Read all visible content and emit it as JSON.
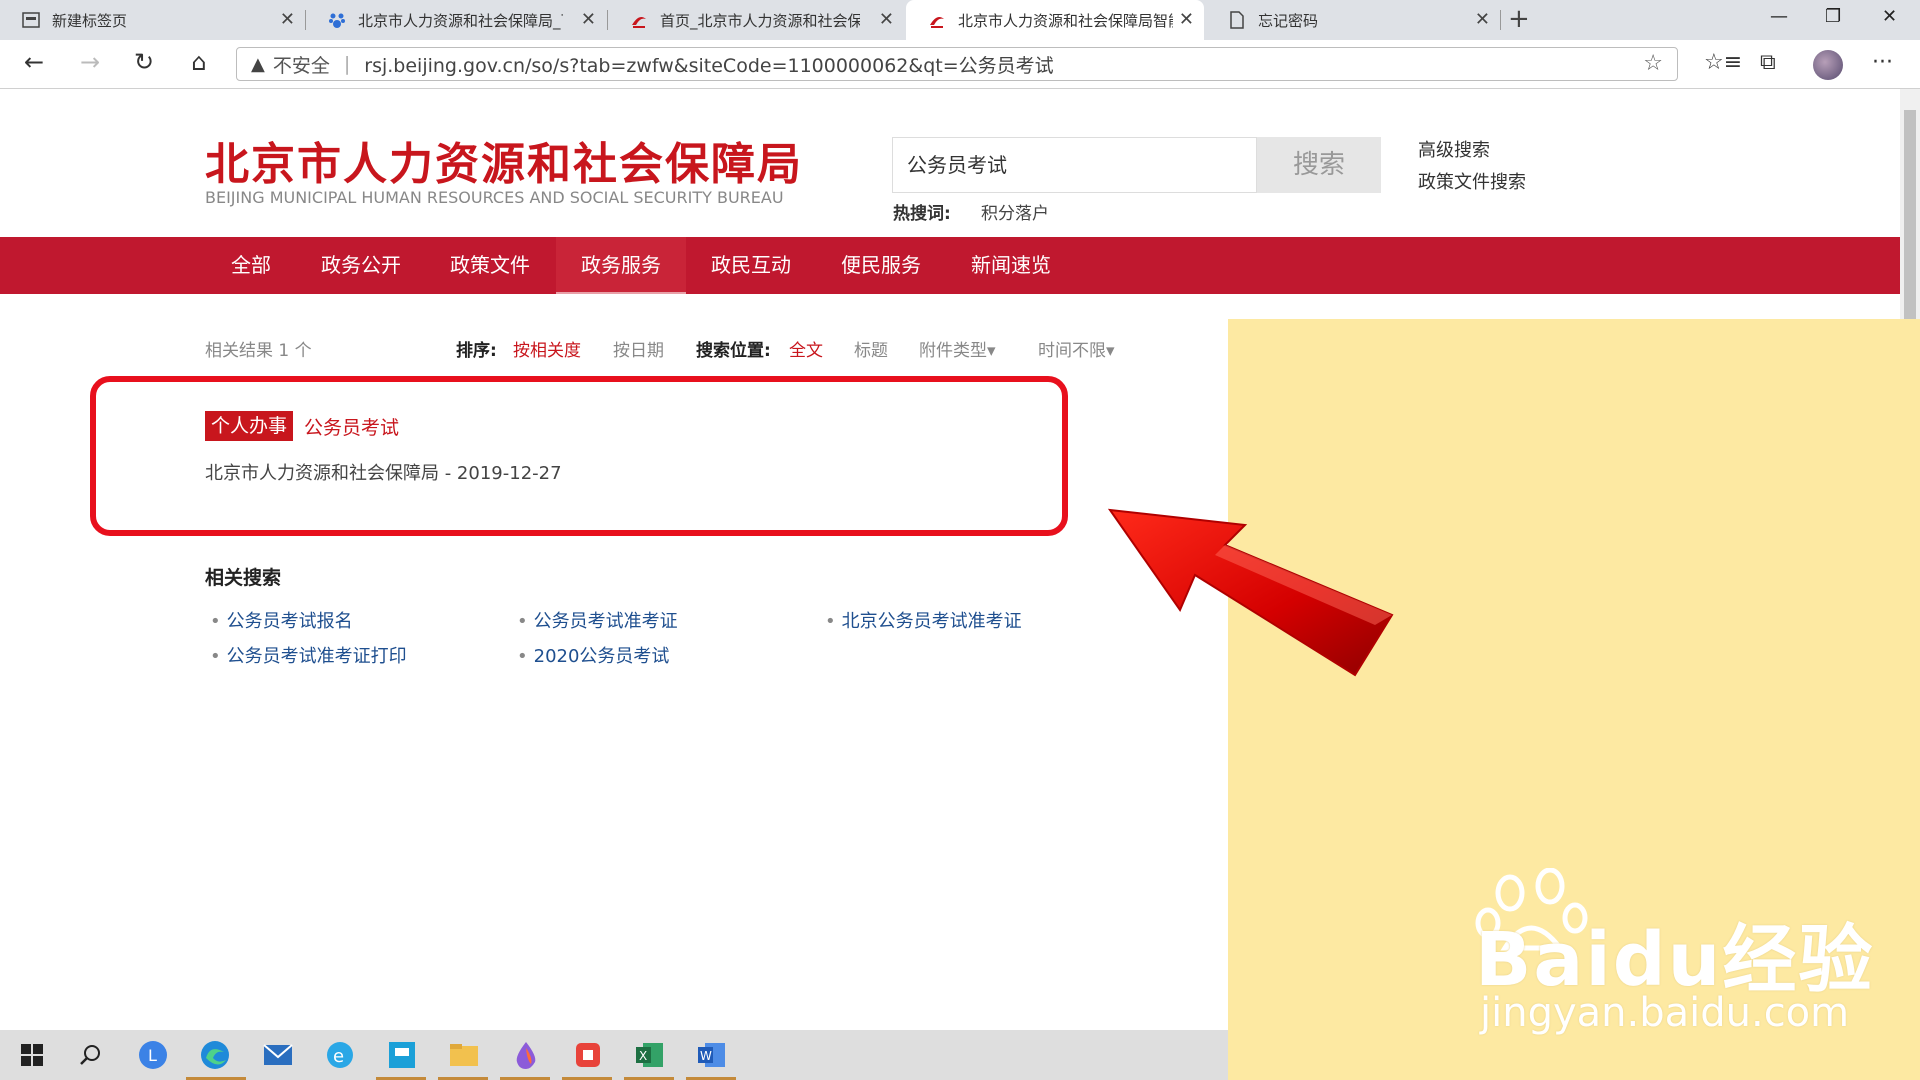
{
  "browser": {
    "tabs": [
      {
        "label": "新建标签页",
        "active": false
      },
      {
        "label": "北京市人力资源和社会保障局_百度",
        "active": false
      },
      {
        "label": "首页_北京市人力资源和社会保障局",
        "active": false
      },
      {
        "label": "北京市人力资源和社会保障局智能",
        "active": true
      },
      {
        "label": "忘记密码",
        "active": false
      }
    ],
    "address": {
      "security_label": "不安全",
      "url": "rsj.beijing.gov.cn/so/s?tab=zwfw&siteCode=1100000062&qt=公务员考试"
    }
  },
  "header": {
    "logo_title": "北京市人力资源和社会保障局",
    "logo_subtitle": "BEIJING MUNICIPAL HUMAN RESOURCES AND SOCIAL SECURITY BUREAU",
    "search_value": "公务员考试",
    "search_button": "搜索",
    "hot_label": "热搜词:",
    "hot_word": "积分落户",
    "advanced_search": "高级搜索",
    "policy_search": "政策文件搜索"
  },
  "nav": {
    "items": [
      "全部",
      "政务公开",
      "政策文件",
      "政务服务",
      "政民互动",
      "便民服务",
      "新闻速览"
    ],
    "active_index": 3
  },
  "filters": {
    "result_count": "相关结果 1 个",
    "sort_label": "排序:",
    "sort_relevance": "按相关度",
    "sort_date": "按日期",
    "position_label": "搜索位置:",
    "position_fulltext": "全文",
    "position_title": "标题",
    "attachment_type": "附件类型▾",
    "time_range": "时间不限▾"
  },
  "result": {
    "tag": "个人办事",
    "title": "公务员考试",
    "meta": "北京市人力资源和社会保障局 - 2019-12-27"
  },
  "related": {
    "title": "相关搜索",
    "links": [
      "公务员考试报名",
      "公务员考试准考证",
      "北京公务员考试准考证",
      "公务员考试准考证打印",
      "2020公务员考试"
    ]
  },
  "watermark": {
    "main": "Baidu经验",
    "sub": "jingyan.baidu.com"
  },
  "colors": {
    "brand_red": "#c8161d",
    "nav_red": "#c0182f",
    "panel_yellow": "#fde9a2",
    "link_blue": "#1f4f8f"
  }
}
